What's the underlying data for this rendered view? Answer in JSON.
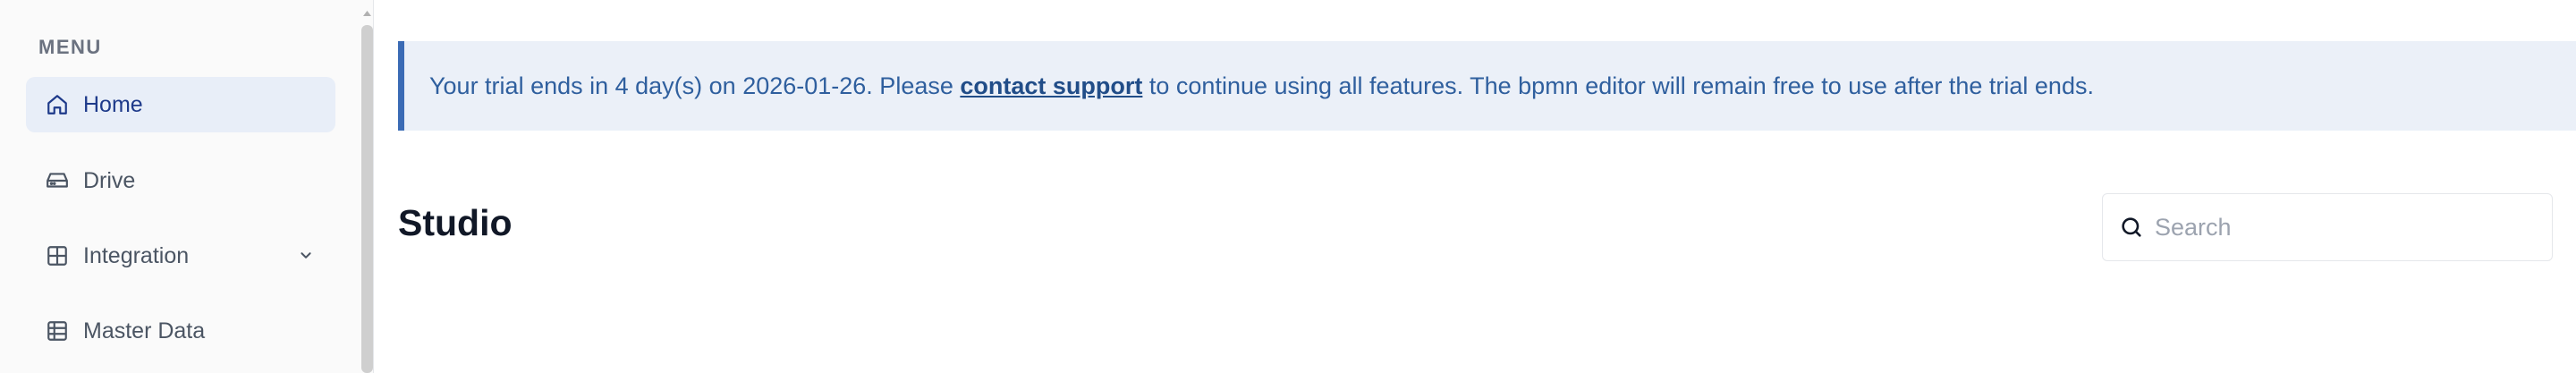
{
  "sidebar": {
    "heading": "MENU",
    "items": [
      {
        "label": "Home",
        "icon": "home-icon",
        "active": true
      },
      {
        "label": "Drive",
        "icon": "drive-icon",
        "active": false
      },
      {
        "label": "Integration",
        "icon": "grid-icon",
        "active": false,
        "expandable": true
      },
      {
        "label": "Master Data",
        "icon": "table-icon",
        "active": false
      }
    ]
  },
  "banner": {
    "text_before": "Your trial ends in 4 day(s) on 2026-01-26. Please ",
    "link": "contact support",
    "text_after": " to continue using all features. The bpmn editor will remain free to use after the trial ends."
  },
  "main": {
    "title": "Studio"
  },
  "search": {
    "placeholder": "Search",
    "value": ""
  },
  "colors": {
    "accent": "#3b6bb5",
    "banner_bg": "#ebf0f8",
    "active_nav_bg": "#e8eef8"
  }
}
